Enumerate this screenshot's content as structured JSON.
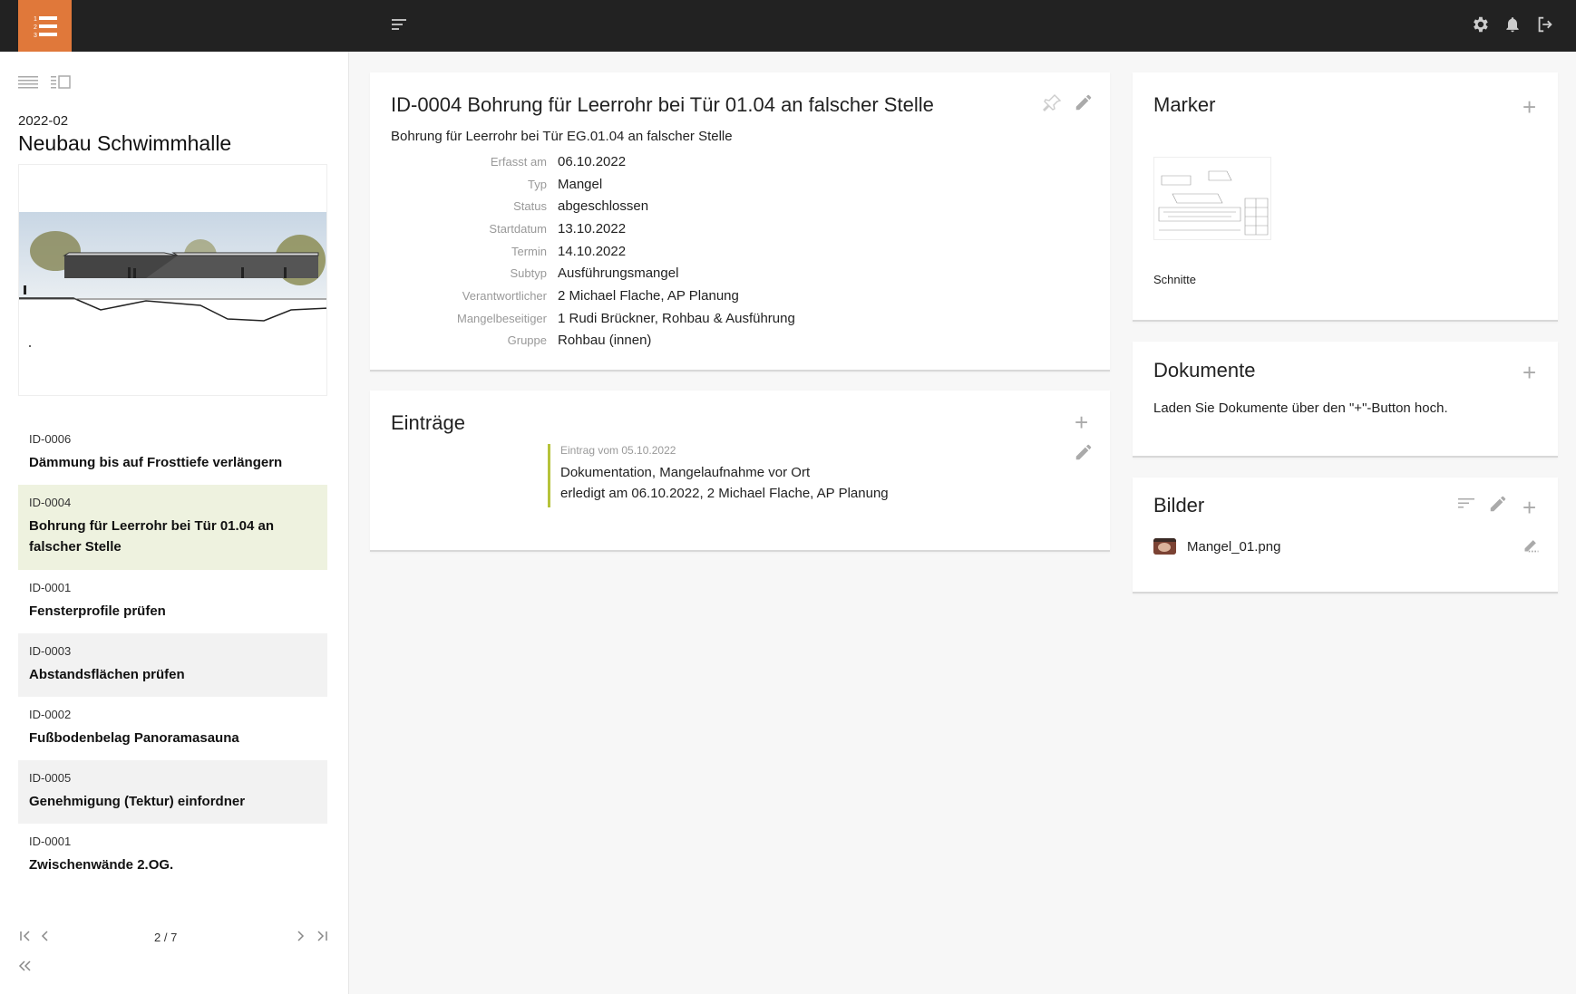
{
  "topbar": {
    "logo_icon": "numbered-list-icon",
    "menu_icon": "menu-icon",
    "icons": [
      "gear-icon",
      "bell-icon",
      "logout-icon"
    ]
  },
  "sidebar": {
    "view_icons": [
      "list-view-icon",
      "split-view-icon"
    ],
    "project_code": "2022-02",
    "project_name": "Neubau Schwimmhalle",
    "items": [
      {
        "id": "ID-0006",
        "title": "Dämmung bis auf Frosttiefe verlängern",
        "state": "normal"
      },
      {
        "id": "ID-0004",
        "title": "Bohrung für Leerrohr bei Tür 01.04 an falscher Stelle",
        "state": "active"
      },
      {
        "id": "ID-0001",
        "title": "Fensterprofile prüfen",
        "state": "normal"
      },
      {
        "id": "ID-0003",
        "title": "Abstandsflächen prüfen",
        "state": "alt"
      },
      {
        "id": "ID-0002",
        "title": "Fußbodenbelag Panoramasauna",
        "state": "normal"
      },
      {
        "id": "ID-0005",
        "title": "Genehmigung (Tektur) einfordner",
        "state": "alt"
      },
      {
        "id": "ID-0001",
        "title": "Zwischenwände 2.OG.",
        "state": "normal"
      }
    ],
    "pager": {
      "count": "2 / 7"
    },
    "collapse_icon": "double-chevron-left-icon"
  },
  "detail": {
    "title": "ID-0004 Bohrung für Leerrohr bei Tür 01.04 an falscher Stelle",
    "subtitle": "Bohrung für Leerrohr bei Tür EG.01.04 an falscher Stelle",
    "properties": [
      {
        "label": "Erfasst am",
        "value": "06.10.2022"
      },
      {
        "label": "Typ",
        "value": "Mangel"
      },
      {
        "label": "Status",
        "value": "abgeschlossen"
      },
      {
        "label": "Startdatum",
        "value": "13.10.2022"
      },
      {
        "label": "Termin",
        "value": "14.10.2022"
      },
      {
        "label": "Subtyp",
        "value": "Ausführungsmangel"
      },
      {
        "label": "Verantwortlicher",
        "value": "2 Michael Flache, AP Planung"
      },
      {
        "label": "Mangelbeseitiger",
        "value": "1 Rudi Brückner, Rohbau & Ausführung"
      },
      {
        "label": "Gruppe",
        "value": "Rohbau (innen)"
      }
    ]
  },
  "entries": {
    "title": "Einträge",
    "items": [
      {
        "date": "Eintrag vom 05.10.2022",
        "line1": "Dokumentation, Mangelaufnahme vor Ort",
        "line2": "erledigt am 06.10.2022, 2 Michael Flache, AP Planung"
      }
    ]
  },
  "marker": {
    "title": "Marker",
    "thumb_label": "Schnitte"
  },
  "documents": {
    "title": "Dokumente",
    "empty_text": "Laden Sie Dokumente über den \"+\"-Button hoch."
  },
  "images": {
    "title": "Bilder",
    "files": [
      {
        "name": "Mangel_01.png"
      }
    ]
  },
  "colors": {
    "accent": "#e0783a",
    "topbar": "#222222",
    "active_row": "#eef2df",
    "entry_border": "#b6c33a"
  }
}
